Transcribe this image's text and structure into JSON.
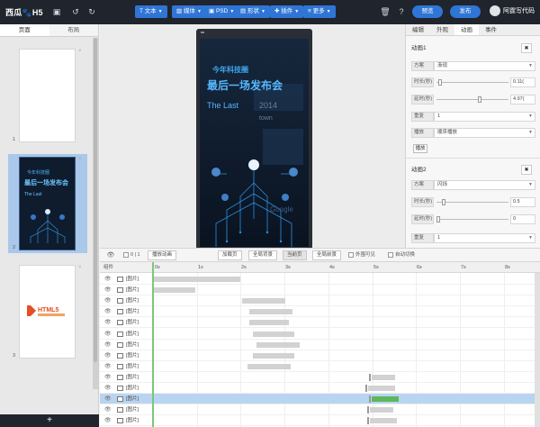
{
  "topbar": {
    "logo": "西瓜",
    "logo_h5": "H5",
    "menus": [
      {
        "icon": "text-icon",
        "label": "文本"
      },
      {
        "icon": "image-icon",
        "label": "媒体"
      },
      {
        "icon": "psd-icon",
        "label": "PSD"
      },
      {
        "icon": "shape-icon",
        "label": "形状"
      },
      {
        "icon": "plugin-icon",
        "label": "插件"
      },
      {
        "icon": "more-icon",
        "label": "更多"
      }
    ],
    "preview_label": "预览",
    "publish_label": "发布",
    "user_name": "阿霆写代码"
  },
  "left_panel": {
    "tabs": [
      "页面",
      "布局"
    ],
    "pages": [
      {
        "num": "1"
      },
      {
        "num": "2"
      },
      {
        "num": "3"
      }
    ],
    "thumb2_line1": "今年科技圈",
    "thumb2_line2": "最后一场发布会",
    "thumb2_line3": "The Last",
    "thumb3_logo": "HTML5",
    "add_label": "+"
  },
  "phone": {
    "line1": "今年科技圈",
    "line2": "最后一场发布会",
    "line3": "The Last",
    "line4": "town",
    "year": "2014",
    "tree_text": "Google"
  },
  "right_panel": {
    "tabs": [
      "编辑",
      "外观",
      "动画",
      "事件"
    ],
    "anim1": {
      "title": "动画1",
      "rows": [
        {
          "label": "方案",
          "value": "渐现"
        },
        {
          "label": "时长(秒)",
          "value": "0.11("
        },
        {
          "label": "延时(秒)",
          "value": "4.97("
        },
        {
          "label": "重复",
          "value": "1"
        },
        {
          "label": "播放",
          "value": "顺序播放"
        }
      ],
      "play": "播放"
    },
    "anim2": {
      "title": "动画2",
      "rows": [
        {
          "label": "方案",
          "value": "闪烁"
        },
        {
          "label": "时长(秒)",
          "value": "0.5"
        },
        {
          "label": "延时(秒)",
          "value": "0"
        },
        {
          "label": "重复",
          "value": "1"
        }
      ]
    }
  },
  "timeline_toolbar": {
    "left_check": "0 | 1",
    "play_anim": "播放动画",
    "buttons": [
      "加载页",
      "全局背景",
      "当前页",
      "全局前景"
    ],
    "check1": "外围可见",
    "check2": "自动切换"
  },
  "timeline": {
    "component_header": "组件",
    "ticks": [
      "0s",
      "1s",
      "2s",
      "3s",
      "4s",
      "5s",
      "6s",
      "7s",
      "8s"
    ],
    "row_label": "[图片]",
    "rows": [
      {
        "label": "[图片]"
      },
      {
        "label": "[图片]"
      },
      {
        "label": "[图片]"
      },
      {
        "label": "[图片]"
      },
      {
        "label": "[图片]"
      },
      {
        "label": "[图片]"
      },
      {
        "label": "[图片]"
      },
      {
        "label": "[图片]"
      },
      {
        "label": "[图片]"
      },
      {
        "label": "[图片]"
      },
      {
        "label": "[图片]"
      },
      {
        "label": "[图片]"
      },
      {
        "label": "[图片]"
      },
      {
        "label": "[图片]"
      }
    ]
  },
  "colors": {
    "topbar": "#20242c",
    "accent": "#2f75d6",
    "selected_row": "#b9d4f0",
    "green": "#5cb85c"
  }
}
